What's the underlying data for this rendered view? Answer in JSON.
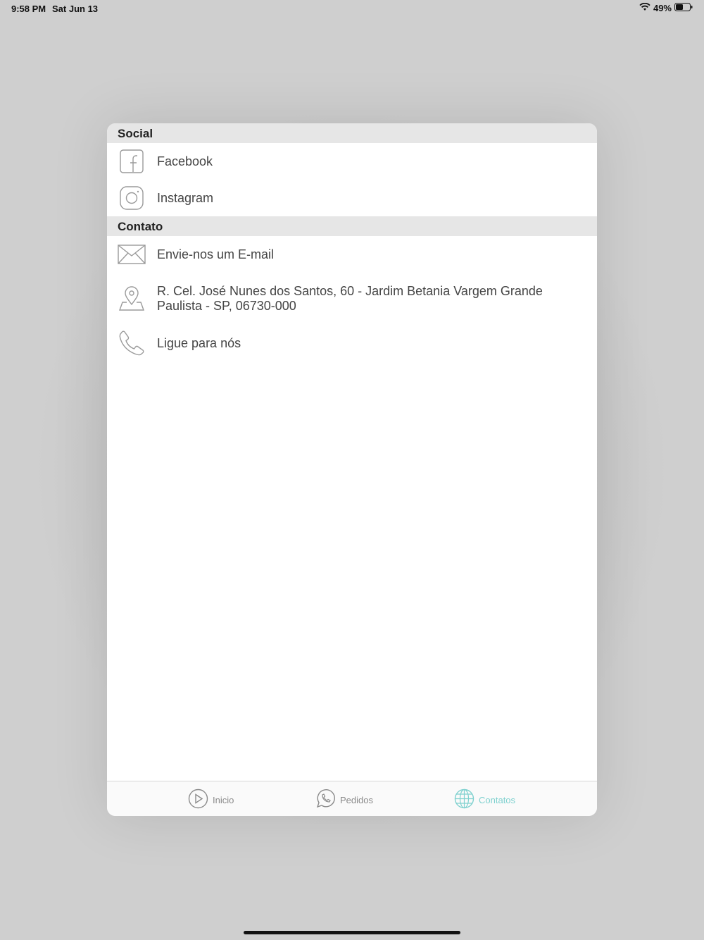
{
  "status_bar": {
    "time": "9:58 PM",
    "date": "Sat Jun 13",
    "battery": "49%"
  },
  "sections": [
    {
      "title": "Social",
      "items": [
        {
          "label": "Facebook",
          "icon": "facebook-icon"
        },
        {
          "label": "Instagram",
          "icon": "instagram-icon"
        }
      ]
    },
    {
      "title": "Contato",
      "items": [
        {
          "label": "Envie-nos um E-mail",
          "icon": "mail-icon"
        },
        {
          "label": "R. Cel. José Nunes dos Santos, 60 - Jardim Betania Vargem Grande Paulista - SP, 06730-000",
          "icon": "map-pin-icon"
        },
        {
          "label": "Ligue para nós",
          "icon": "phone-icon"
        }
      ]
    }
  ],
  "tabbar": {
    "tabs": [
      {
        "label": "Inicio",
        "icon": "play-icon",
        "active": false
      },
      {
        "label": "Pedidos",
        "icon": "whatsapp-icon",
        "active": false
      },
      {
        "label": "Contatos",
        "icon": "globe-icon",
        "active": true
      }
    ]
  },
  "colors": {
    "accent": "#7fd1cf",
    "section_header_bg": "#e6e6e6",
    "icon_stroke": "#9a9a9a"
  }
}
